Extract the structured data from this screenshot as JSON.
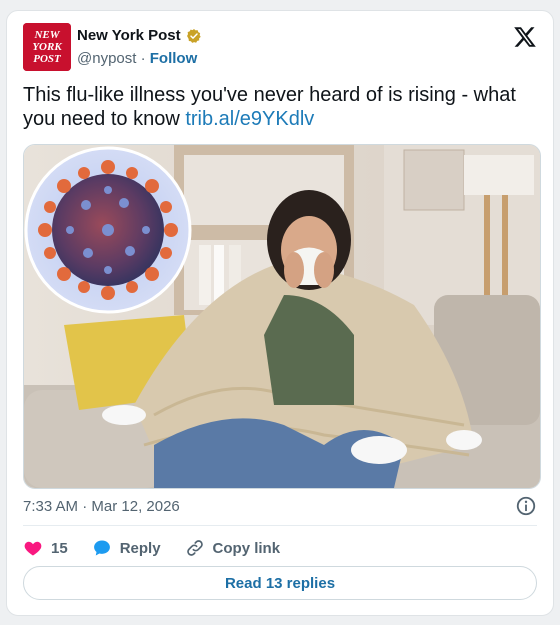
{
  "author": {
    "display_name": "New York Post",
    "handle": "@nypost",
    "separator": "·",
    "follow_label": "Follow",
    "logo_lines": [
      "NEW",
      "YORK",
      "POST"
    ]
  },
  "tweet": {
    "text": "This flu-like illness you've never heard of is rising - what you need to know ",
    "link": "trib.al/e9YKdlv"
  },
  "meta": {
    "time": "7:33 AM",
    "separator": "·",
    "date": "Mar 12, 2026"
  },
  "actions": {
    "like_count": "15",
    "reply_label": "Reply",
    "copy_link_label": "Copy link"
  },
  "replies_button_label": "Read 13 replies",
  "colors": {
    "brand_red": "#c8102e",
    "link_blue": "#1d7bb8",
    "like_pink": "#f91880",
    "reply_blue": "#1d9bf0"
  },
  "icons": {
    "verified": "verified-badge-icon",
    "x_logo": "x-logo-icon",
    "info": "info-icon",
    "like": "heart-icon",
    "reply": "speech-bubble-icon",
    "copy_link": "link-icon"
  }
}
